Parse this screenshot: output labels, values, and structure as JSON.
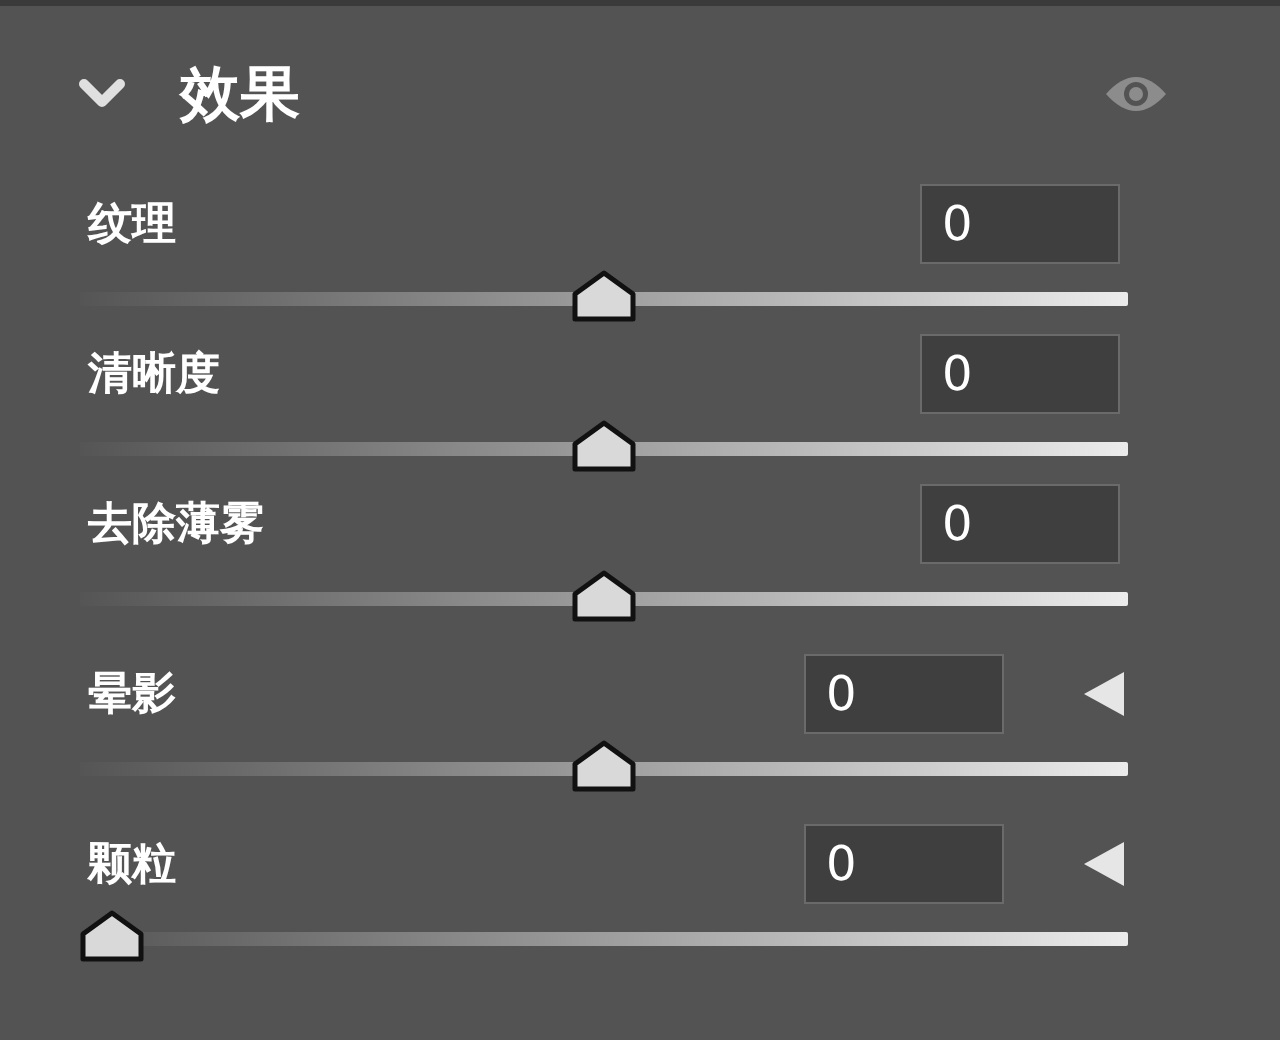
{
  "panel": {
    "title": "效果",
    "expanded": true
  },
  "sliders": [
    {
      "label": "纹理",
      "value": "0",
      "level": 0.5,
      "kind": "plain"
    },
    {
      "label": "清晰度",
      "value": "0",
      "level": 0.5,
      "kind": "plain"
    },
    {
      "label": "去除薄雾",
      "value": "0",
      "level": 0.5,
      "kind": "plain"
    },
    {
      "label": "晕影",
      "value": "0",
      "level": 0.5,
      "kind": "expandable"
    },
    {
      "label": "颗粒",
      "value": "0",
      "level": 0,
      "kind": "expandable"
    }
  ]
}
